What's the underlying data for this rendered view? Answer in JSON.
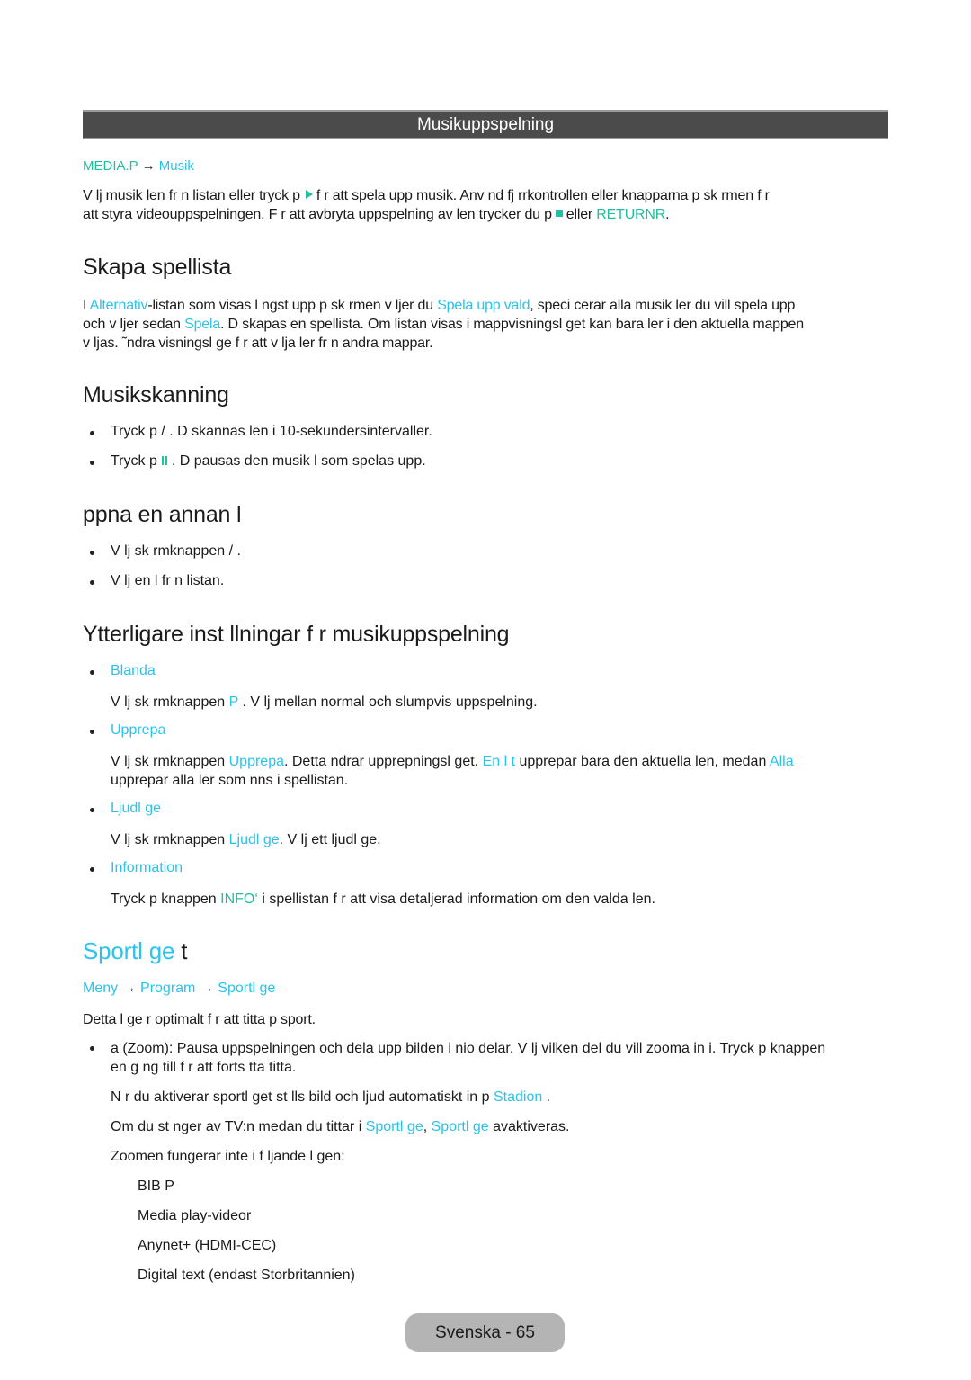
{
  "section_header": "Musikuppspelning",
  "breadcrumb1": {
    "item1": "MEDIA.P",
    "arrow": "→",
    "item2": "Musik"
  },
  "intro": {
    "line1_a": "V lj musik len fr n listan eller tryck p",
    "line1_b": "f r att spela upp musik. Anv nd fj rrkontrollen eller knapparna p  sk rmen f r",
    "line2_a": "att styra videouppspelningen. F r att avbryta uppspelning av  len trycker du p",
    "line2_b": "eller",
    "returnr": "RETURNR",
    "line2_end": "."
  },
  "skapa": {
    "title": "Skapa spellista",
    "p1_a": "I ",
    "alternativ": "Alternativ",
    "p1_b": "-listan som visas l ngst upp p  sk rmen v ljer du ",
    "spela_upp_vald": "Spela upp vald",
    "p1_c": ", speci cerar alla musik ler du vill spela upp",
    "p2_a": "och v ljer sedan ",
    "spela": "Spela",
    "p2_b": ". D  skapas en spellista. Om listan visas i mappvisningsl get kan bara  ler i den aktuella mappen",
    "p3": "v ljas. ˜ndra visningsl ge f r att v lja  ler fr n andra mappar."
  },
  "musikskanning": {
    "title": "Musikskanning",
    "bullet1": "Tryck p     / . D  skannas  len i 10-sekundersintervaller.",
    "bullet2_a": "Tryck p",
    "bullet2_b": ". D  pausas den musik l som spelas upp."
  },
  "oppna": {
    "title": " ppna en annan  l",
    "bullet1": "V lj sk rmknappen     /     .",
    "bullet2": "V lj en  l fr n listan."
  },
  "ytterligare": {
    "title": "Ytterligare inst llningar f r musikuppspelning",
    "blanda_label": "Blanda",
    "blanda_text_a": "V lj sk rmknappen ",
    "blanda_p": "P",
    "blanda_text_b": " . V lj mellan normal och slumpvis uppspelning.",
    "upprepa_label": "Upprepa",
    "upprepa_a": "V lj sk rmknappen ",
    "upprepa_link": "Upprepa",
    "upprepa_b": ". Detta  ndrar upprepningsl get. ",
    "en_lat": "En l t",
    "upprepa_c": " upprepar bara den aktuella  len, medan ",
    "alla": "Alla",
    "upprepa_d": "upprepar alla  ler som  nns i spellistan.",
    "ljudlage_label": "Ljudl ge",
    "ljudlage_a": "V lj sk rmknappen ",
    "ljudlage_link": "Ljudl ge",
    "ljudlage_b": ". V lj ett ljudl ge.",
    "info_label": "Information",
    "info_a": "Tryck p  knappen ",
    "info_key": "INFO‘",
    "info_b": " i spellistan f r att visa detaljerad information om den valda  len."
  },
  "sport": {
    "title_a": "Sportl ge",
    "title_b": " t",
    "crumb": {
      "item1": "Meny",
      "arrow": "→",
      "item2": "Program",
      "item3": "Sportl ge"
    },
    "desc": "Detta l ge  r optimalt f r att titta p  sport.",
    "zoom_line1": "a (Zoom): Pausa uppspelningen och dela upp bilden i nio delar. V lj vilken del du vill zooma in i. Tryck p  knappen",
    "zoom_line2": "en g ng till f r att forts tta titta.",
    "note1_a": "N r du aktiverar sportl get st lls bild och ljud automatiskt in p  ",
    "stadion": "Stadion",
    "note1_b": " .",
    "note2_a": "Om du st nger av TV:n medan du tittar i ",
    "sportlage1": "Sportl ge",
    "note2_b": ", ",
    "sportlage2": "Sportl ge",
    "note2_c": "  avaktiveras.",
    "zoom_not": "Zoomen fungerar inte i f ljande l gen:",
    "modes": [
      "BIB P",
      "Media play-videor",
      "Anynet+ (HDMI-CEC)",
      "Digital text (endast Storbritannien)"
    ]
  },
  "footer": {
    "page_label": "Svenska - 65"
  },
  "colors": {
    "accent_blue": "#29c3ec",
    "accent_green": "#1fbf9f",
    "header_bar": "#4b4b4b"
  }
}
